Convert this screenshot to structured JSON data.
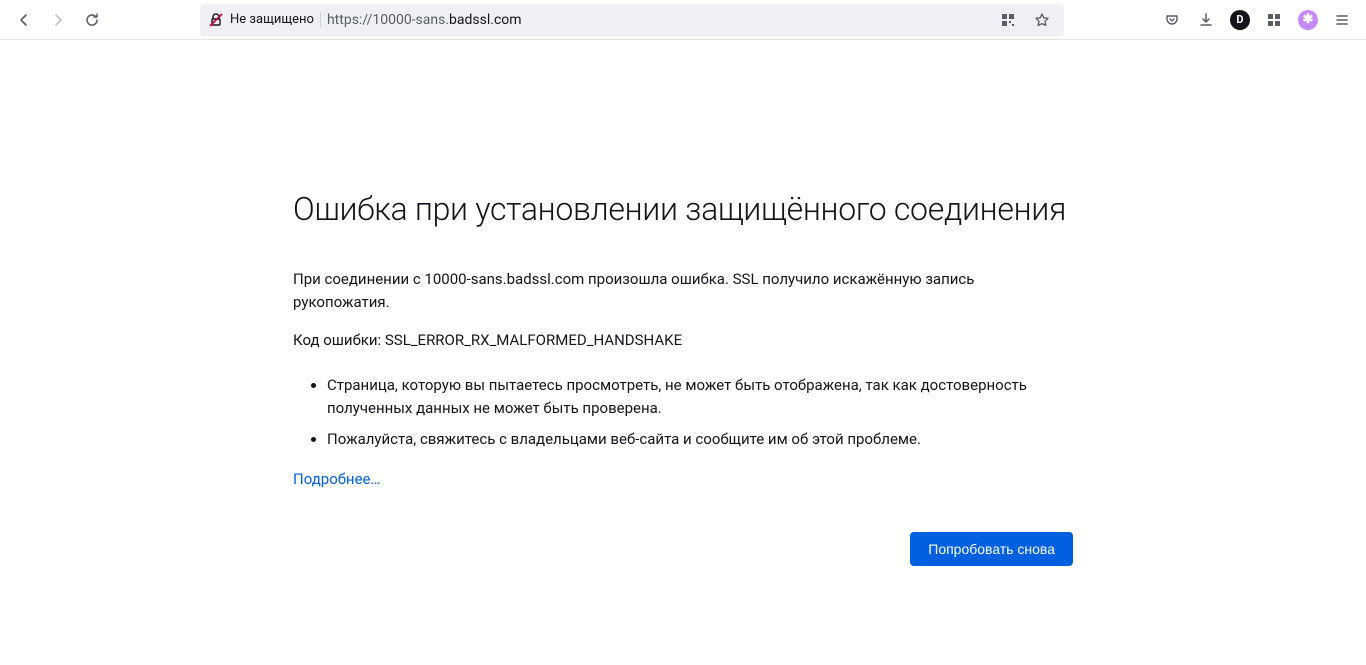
{
  "toolbar": {
    "security_label": "Не защищено",
    "url_scheme": "https://",
    "url_sub": "10000-sans.",
    "url_host": "badssl.com"
  },
  "error": {
    "title": "Ошибка при установлении защищённого соединения",
    "msg1": "При соединении с 10000-sans.badssl.com произошла ошибка. SSL получило искажённую запись рукопожатия.",
    "msg2": "Код ошибки: SSL_ERROR_RX_MALFORMED_HANDSHAKE",
    "bullets": [
      "Страница, которую вы пытаетесь просмотреть, не может быть отображена, так как достоверность полученных данных не может быть проверена.",
      "Пожалуйста, свяжитесь с владельцами веб-сайта и сообщите им об этой проблеме."
    ],
    "more": "Подробнее…",
    "retry": "Попробовать снова"
  }
}
